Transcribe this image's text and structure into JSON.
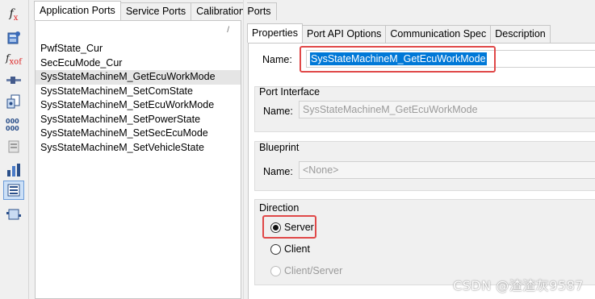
{
  "toolbar": {
    "items": [
      {
        "icon": "function-icon",
        "glyph": "f",
        "sub": "x"
      },
      {
        "icon": "database-icon"
      },
      {
        "icon": "function-compose-icon",
        "glyph": "f",
        "sub": "xof"
      },
      {
        "icon": "port-connector-icon"
      },
      {
        "icon": "document-settings-icon"
      },
      {
        "icon": "values-icon"
      },
      {
        "icon": "component-stack-icon"
      },
      {
        "icon": "bar-chart-icon"
      },
      {
        "icon": "port-list-icon",
        "active": true
      },
      {
        "icon": "component-diagram-icon"
      }
    ]
  },
  "left_tabs": [
    "Application Ports",
    "Service Ports",
    "Calibration Ports"
  ],
  "left_tab_active": "Application Ports",
  "list_corner_mark": "/",
  "ports": [
    "PwfState_Cur",
    "SecEcuMode_Cur",
    "SysStateMachineM_GetEcuWorkMode",
    "SysStateMachineM_SetComState",
    "SysStateMachineM_SetEcuWorkMode",
    "SysStateMachineM_SetPowerState",
    "SysStateMachineM_SetSecEcuMode",
    "SysStateMachineM_SetVehicleState"
  ],
  "selected_port": "SysStateMachineM_GetEcuWorkMode",
  "right_tabs": [
    "Properties",
    "Port API Options",
    "Communication Spec",
    "Description"
  ],
  "right_tab_active": "Properties",
  "properties": {
    "name_label": "Name:",
    "name_value": "SysStateMachineM_GetEcuWorkMode",
    "port_interface": {
      "title": "Port Interface",
      "name_label": "Name:",
      "name_value": "SysStateMachineM_GetEcuWorkMode"
    },
    "blueprint": {
      "title": "Blueprint",
      "name_label": "Name:",
      "name_value": "<None>"
    },
    "direction": {
      "title": "Direction",
      "options": [
        "Server",
        "Client",
        "Client/Server"
      ],
      "selected": "Server",
      "disabled": [
        "Client/Server"
      ]
    }
  },
  "colors": {
    "highlight": "#e04848",
    "selection": "#0078d7"
  },
  "watermark": "CSDN @渣渣灰9587"
}
